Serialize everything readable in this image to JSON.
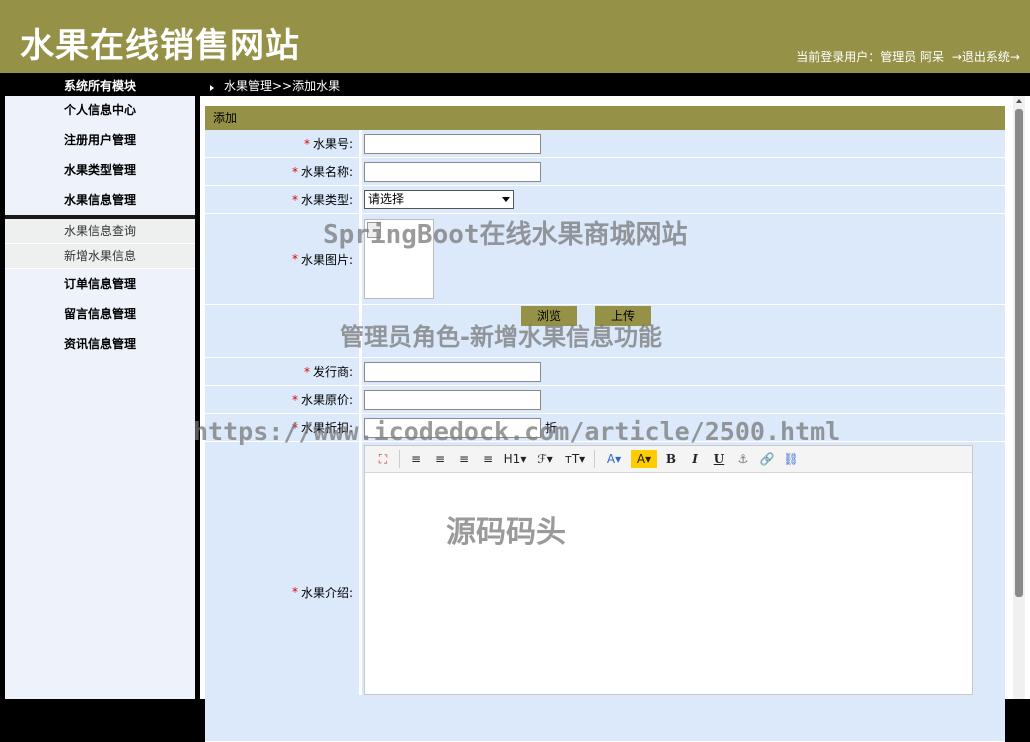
{
  "header": {
    "site_title": "水果在线销售网站",
    "user_label": "当前登录用户：管理员 阿呆",
    "logout": "→退出系统→"
  },
  "sidebar": {
    "title": "系统所有模块",
    "items": [
      {
        "label": "个人信息中心"
      },
      {
        "label": "注册用户管理"
      },
      {
        "label": "水果类型管理"
      },
      {
        "label": "水果信息管理"
      }
    ],
    "sub_items": [
      {
        "label": "水果信息查询"
      },
      {
        "label": "新增水果信息"
      }
    ],
    "items_after": [
      {
        "label": "订单信息管理"
      },
      {
        "label": "留言信息管理"
      },
      {
        "label": "资讯信息管理"
      }
    ]
  },
  "breadcrumb": "水果管理>>添加水果",
  "form": {
    "panel_title": "添加",
    "required_mark": "*",
    "fields": {
      "fruit_no": "水果号:",
      "fruit_name": "水果名称:",
      "fruit_type": "水果类型:",
      "fruit_image": "水果图片:",
      "publisher": "发行商:",
      "original_price": "水果原价:",
      "discount": "水果折扣:",
      "intro": "水果介绍:"
    },
    "type_select_value": "请选择",
    "discount_suffix": "折",
    "browse_button": "浏览",
    "upload_button": "上传"
  },
  "editor_toolbar": {
    "fullscreen": "⛶",
    "align_left": "≡",
    "align_center": "≡",
    "align_right": "≡",
    "justify": "≡",
    "heading": "H1▾",
    "font": "ℱ▾",
    "font_size": "тT▾",
    "font_color": "A▾",
    "bg_color": "A▾",
    "bold": "B",
    "italic": "I",
    "underline": "U",
    "anchor": "⚓",
    "link": "🔗",
    "unlink": "⛓"
  },
  "watermarks": {
    "w1": "SpringBoot在线水果商城网站",
    "w2": "管理员角色-新增水果信息功能",
    "w3": "https://www.icodedock.com/article/2500.html",
    "w4": "源码码头"
  }
}
